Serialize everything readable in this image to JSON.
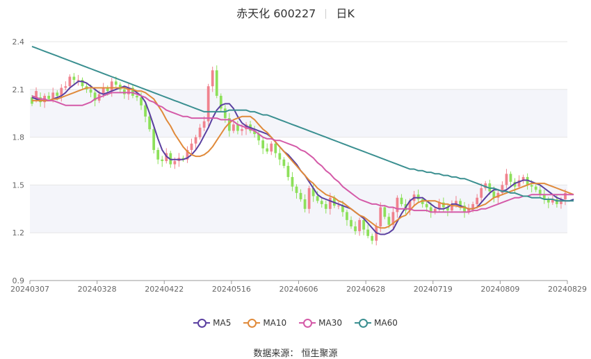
{
  "header": {
    "title": "赤天化 600227",
    "period": "日K"
  },
  "source": "数据来源： 恒生聚源",
  "chart_data": {
    "type": "candlestick",
    "title": "赤天化 600227",
    "ylim": [
      0.9,
      2.4
    ],
    "yticks": [
      "2.4",
      "2.1",
      "1.8",
      "1.5",
      "1.2",
      "0.9"
    ],
    "xticks": [
      "20240307",
      "20240328",
      "20240422",
      "20240516",
      "20240606",
      "20240628",
      "20240719",
      "20240809",
      "20240829"
    ],
    "grid": true,
    "legend_position": "bottom",
    "colors": {
      "up": "#f0828e",
      "down": "#8de05a",
      "bandFill": "#f4f5fa",
      "grid": "#e6e6e6",
      "axis": "#999999"
    },
    "series": [
      {
        "name": "MA5",
        "color": "#5a3fa0",
        "values": [
          2.05,
          2.04,
          2.03,
          2.03,
          2.03,
          2.04,
          2.05,
          2.06,
          2.08,
          2.11,
          2.13,
          2.15,
          2.15,
          2.14,
          2.12,
          2.1,
          2.08,
          2.07,
          2.08,
          2.09,
          2.1,
          2.11,
          2.12,
          2.11,
          2.1,
          2.08,
          2.06,
          2.02,
          1.95,
          1.87,
          1.79,
          1.72,
          1.68,
          1.66,
          1.66,
          1.66,
          1.66,
          1.67,
          1.69,
          1.72,
          1.76,
          1.81,
          1.86,
          1.92,
          1.97,
          2.0,
          2.01,
          2.01,
          1.98,
          1.93,
          1.89,
          1.87,
          1.86,
          1.85,
          1.84,
          1.83,
          1.82,
          1.8,
          1.77,
          1.74,
          1.71,
          1.69,
          1.66,
          1.63,
          1.59,
          1.56,
          1.52,
          1.48,
          1.44,
          1.42,
          1.41,
          1.4,
          1.39,
          1.38,
          1.37,
          1.36,
          1.35,
          1.33,
          1.31,
          1.29,
          1.26,
          1.23,
          1.2,
          1.19,
          1.19,
          1.2,
          1.22,
          1.27,
          1.32,
          1.36,
          1.4,
          1.42,
          1.42,
          1.42,
          1.4,
          1.38,
          1.36,
          1.35,
          1.35,
          1.36,
          1.38,
          1.38,
          1.37,
          1.36,
          1.35,
          1.35,
          1.36,
          1.39,
          1.42,
          1.45,
          1.47,
          1.47,
          1.46,
          1.47,
          1.49,
          1.51,
          1.52,
          1.53,
          1.53,
          1.52,
          1.51,
          1.5,
          1.48,
          1.46,
          1.44,
          1.42,
          1.41,
          1.4,
          1.4,
          1.41
        ]
      },
      {
        "name": "MA10",
        "color": "#e08a3a",
        "values": [
          2.03,
          2.03,
          2.03,
          2.03,
          2.03,
          2.04,
          2.04,
          2.05,
          2.06,
          2.07,
          2.08,
          2.09,
          2.1,
          2.11,
          2.11,
          2.11,
          2.11,
          2.11,
          2.11,
          2.11,
          2.11,
          2.11,
          2.11,
          2.1,
          2.1,
          2.09,
          2.09,
          2.08,
          2.06,
          2.04,
          2.0,
          1.96,
          1.91,
          1.87,
          1.82,
          1.78,
          1.74,
          1.71,
          1.69,
          1.68,
          1.68,
          1.69,
          1.71,
          1.74,
          1.78,
          1.82,
          1.86,
          1.89,
          1.91,
          1.92,
          1.93,
          1.93,
          1.93,
          1.91,
          1.88,
          1.85,
          1.83,
          1.8,
          1.77,
          1.74,
          1.71,
          1.68,
          1.65,
          1.62,
          1.59,
          1.56,
          1.53,
          1.51,
          1.48,
          1.46,
          1.44,
          1.43,
          1.42,
          1.4,
          1.39,
          1.37,
          1.35,
          1.33,
          1.31,
          1.3,
          1.28,
          1.26,
          1.24,
          1.23,
          1.23,
          1.24,
          1.26,
          1.28,
          1.3,
          1.31,
          1.34,
          1.37,
          1.39,
          1.4,
          1.4,
          1.4,
          1.4,
          1.39,
          1.38,
          1.38,
          1.37,
          1.37,
          1.36,
          1.36,
          1.35,
          1.35,
          1.36,
          1.37,
          1.38,
          1.4,
          1.42,
          1.43,
          1.44,
          1.45,
          1.46,
          1.47,
          1.48,
          1.49,
          1.5,
          1.51,
          1.51,
          1.51,
          1.51,
          1.5,
          1.49,
          1.48,
          1.47,
          1.46,
          1.45,
          1.44
        ]
      },
      {
        "name": "MA30",
        "color": "#d45aa8",
        "values": [
          2.06,
          2.05,
          2.04,
          2.04,
          2.03,
          2.03,
          2.02,
          2.01,
          2.0,
          2.0,
          2.0,
          2.0,
          2.0,
          2.01,
          2.02,
          2.04,
          2.05,
          2.06,
          2.07,
          2.08,
          2.08,
          2.08,
          2.08,
          2.08,
          2.08,
          2.07,
          2.06,
          2.05,
          2.03,
          2.02,
          2.0,
          1.99,
          1.97,
          1.96,
          1.95,
          1.94,
          1.93,
          1.93,
          1.92,
          1.92,
          1.92,
          1.92,
          1.92,
          1.92,
          1.92,
          1.91,
          1.91,
          1.91,
          1.9,
          1.88,
          1.87,
          1.86,
          1.85,
          1.84,
          1.82,
          1.8,
          1.79,
          1.79,
          1.78,
          1.78,
          1.77,
          1.76,
          1.75,
          1.74,
          1.72,
          1.71,
          1.69,
          1.67,
          1.64,
          1.62,
          1.59,
          1.57,
          1.54,
          1.52,
          1.49,
          1.47,
          1.45,
          1.43,
          1.41,
          1.4,
          1.39,
          1.38,
          1.38,
          1.37,
          1.37,
          1.36,
          1.36,
          1.35,
          1.35,
          1.35,
          1.35,
          1.34,
          1.34,
          1.34,
          1.34,
          1.33,
          1.33,
          1.33,
          1.33,
          1.33,
          1.33,
          1.33,
          1.33,
          1.33,
          1.33,
          1.34,
          1.34,
          1.35,
          1.35,
          1.36,
          1.37,
          1.38,
          1.39,
          1.4,
          1.41,
          1.42,
          1.42,
          1.43,
          1.43,
          1.44,
          1.44,
          1.44,
          1.44,
          1.44,
          1.44,
          1.44,
          1.44,
          1.44,
          1.44,
          1.44
        ]
      },
      {
        "name": "MA60",
        "color": "#3a8f90",
        "values": [
          2.37,
          2.36,
          2.35,
          2.34,
          2.33,
          2.32,
          2.31,
          2.3,
          2.29,
          2.28,
          2.27,
          2.26,
          2.25,
          2.24,
          2.23,
          2.22,
          2.21,
          2.2,
          2.19,
          2.18,
          2.17,
          2.16,
          2.15,
          2.14,
          2.13,
          2.12,
          2.11,
          2.1,
          2.09,
          2.08,
          2.07,
          2.06,
          2.05,
          2.04,
          2.03,
          2.02,
          2.01,
          2.0,
          1.99,
          1.98,
          1.97,
          1.96,
          1.96,
          1.96,
          1.96,
          1.96,
          1.96,
          1.97,
          1.97,
          1.97,
          1.97,
          1.97,
          1.96,
          1.96,
          1.95,
          1.94,
          1.94,
          1.93,
          1.92,
          1.91,
          1.9,
          1.89,
          1.88,
          1.87,
          1.86,
          1.85,
          1.84,
          1.83,
          1.82,
          1.81,
          1.8,
          1.79,
          1.78,
          1.77,
          1.76,
          1.75,
          1.74,
          1.73,
          1.72,
          1.71,
          1.7,
          1.69,
          1.68,
          1.67,
          1.66,
          1.65,
          1.64,
          1.63,
          1.62,
          1.61,
          1.6,
          1.6,
          1.59,
          1.59,
          1.58,
          1.58,
          1.57,
          1.57,
          1.56,
          1.56,
          1.55,
          1.55,
          1.54,
          1.54,
          1.53,
          1.52,
          1.51,
          1.5,
          1.49,
          1.48,
          1.48,
          1.47,
          1.46,
          1.46,
          1.45,
          1.45,
          1.44,
          1.43,
          1.43,
          1.42,
          1.42,
          1.42,
          1.41,
          1.41,
          1.41,
          1.4,
          1.4,
          1.4,
          1.4,
          1.4
        ]
      }
    ],
    "candles": [
      [
        2.05,
        2.01
      ],
      [
        2.04,
        2.09
      ],
      [
        2.05,
        2.02
      ],
      [
        2.02,
        2.06
      ],
      [
        2.06,
        2.04
      ],
      [
        2.04,
        2.08
      ],
      [
        2.08,
        2.06
      ],
      [
        2.06,
        2.11
      ],
      [
        2.11,
        2.12
      ],
      [
        2.12,
        2.18
      ],
      [
        2.18,
        2.16
      ],
      [
        2.16,
        2.16
      ],
      [
        2.16,
        2.12
      ],
      [
        2.12,
        2.1
      ],
      [
        2.1,
        2.08
      ],
      [
        2.08,
        2.03
      ],
      [
        2.03,
        2.07
      ],
      [
        2.07,
        2.11
      ],
      [
        2.11,
        2.09
      ],
      [
        2.09,
        2.15
      ],
      [
        2.15,
        2.13
      ],
      [
        2.13,
        2.1
      ],
      [
        2.1,
        2.07
      ],
      [
        2.07,
        2.11
      ],
      [
        2.11,
        2.06
      ],
      [
        2.06,
        2.05
      ],
      [
        2.05,
        2.0
      ],
      [
        2.0,
        1.93
      ],
      [
        1.93,
        1.85
      ],
      [
        1.85,
        1.72
      ],
      [
        1.72,
        1.66
      ],
      [
        1.66,
        1.65
      ],
      [
        1.65,
        1.7
      ],
      [
        1.7,
        1.63
      ],
      [
        1.63,
        1.65
      ],
      [
        1.65,
        1.67
      ],
      [
        1.67,
        1.66
      ],
      [
        1.66,
        1.72
      ],
      [
        1.72,
        1.76
      ],
      [
        1.76,
        1.8
      ],
      [
        1.8,
        1.86
      ],
      [
        1.86,
        1.9
      ],
      [
        1.9,
        2.12
      ],
      [
        2.12,
        2.22
      ],
      [
        2.22,
        2.06
      ],
      [
        2.06,
        1.98
      ],
      [
        1.98,
        1.92
      ],
      [
        1.92,
        1.84
      ],
      [
        1.84,
        1.88
      ],
      [
        1.88,
        1.84
      ],
      [
        1.84,
        1.85
      ],
      [
        1.85,
        1.88
      ],
      [
        1.88,
        1.84
      ],
      [
        1.84,
        1.82
      ],
      [
        1.82,
        1.78
      ],
      [
        1.78,
        1.73
      ],
      [
        1.73,
        1.71
      ],
      [
        1.71,
        1.76
      ],
      [
        1.76,
        1.7
      ],
      [
        1.7,
        1.66
      ],
      [
        1.66,
        1.62
      ],
      [
        1.62,
        1.55
      ],
      [
        1.55,
        1.49
      ],
      [
        1.49,
        1.45
      ],
      [
        1.45,
        1.41
      ],
      [
        1.41,
        1.35
      ],
      [
        1.35,
        1.48
      ],
      [
        1.48,
        1.43
      ],
      [
        1.43,
        1.4
      ],
      [
        1.4,
        1.38
      ],
      [
        1.38,
        1.35
      ],
      [
        1.35,
        1.42
      ],
      [
        1.42,
        1.37
      ],
      [
        1.37,
        1.37
      ],
      [
        1.37,
        1.33
      ],
      [
        1.33,
        1.28
      ],
      [
        1.28,
        1.24
      ],
      [
        1.24,
        1.21
      ],
      [
        1.21,
        1.28
      ],
      [
        1.28,
        1.22
      ],
      [
        1.22,
        1.18
      ],
      [
        1.18,
        1.15
      ],
      [
        1.15,
        1.24
      ],
      [
        1.24,
        1.36
      ],
      [
        1.36,
        1.3
      ],
      [
        1.3,
        1.25
      ],
      [
        1.25,
        1.33
      ],
      [
        1.33,
        1.42
      ],
      [
        1.42,
        1.38
      ],
      [
        1.38,
        1.34
      ],
      [
        1.34,
        1.4
      ],
      [
        1.4,
        1.44
      ],
      [
        1.44,
        1.41
      ],
      [
        1.41,
        1.38
      ],
      [
        1.38,
        1.36
      ],
      [
        1.36,
        1.33
      ],
      [
        1.33,
        1.35
      ],
      [
        1.35,
        1.39
      ],
      [
        1.39,
        1.36
      ],
      [
        1.36,
        1.34
      ],
      [
        1.34,
        1.38
      ],
      [
        1.38,
        1.4
      ],
      [
        1.4,
        1.37
      ],
      [
        1.37,
        1.33
      ],
      [
        1.33,
        1.35
      ],
      [
        1.35,
        1.38
      ],
      [
        1.38,
        1.42
      ],
      [
        1.42,
        1.48
      ],
      [
        1.48,
        1.51
      ],
      [
        1.51,
        1.46
      ],
      [
        1.46,
        1.42
      ],
      [
        1.42,
        1.45
      ],
      [
        1.45,
        1.5
      ],
      [
        1.5,
        1.57
      ],
      [
        1.57,
        1.52
      ],
      [
        1.52,
        1.49
      ],
      [
        1.49,
        1.53
      ],
      [
        1.53,
        1.55
      ],
      [
        1.55,
        1.5
      ],
      [
        1.5,
        1.49
      ],
      [
        1.49,
        1.47
      ],
      [
        1.47,
        1.44
      ],
      [
        1.44,
        1.41
      ],
      [
        1.41,
        1.39
      ],
      [
        1.39,
        1.41
      ],
      [
        1.41,
        1.38
      ],
      [
        1.38,
        1.41
      ],
      [
        1.41,
        1.45
      ]
    ]
  }
}
